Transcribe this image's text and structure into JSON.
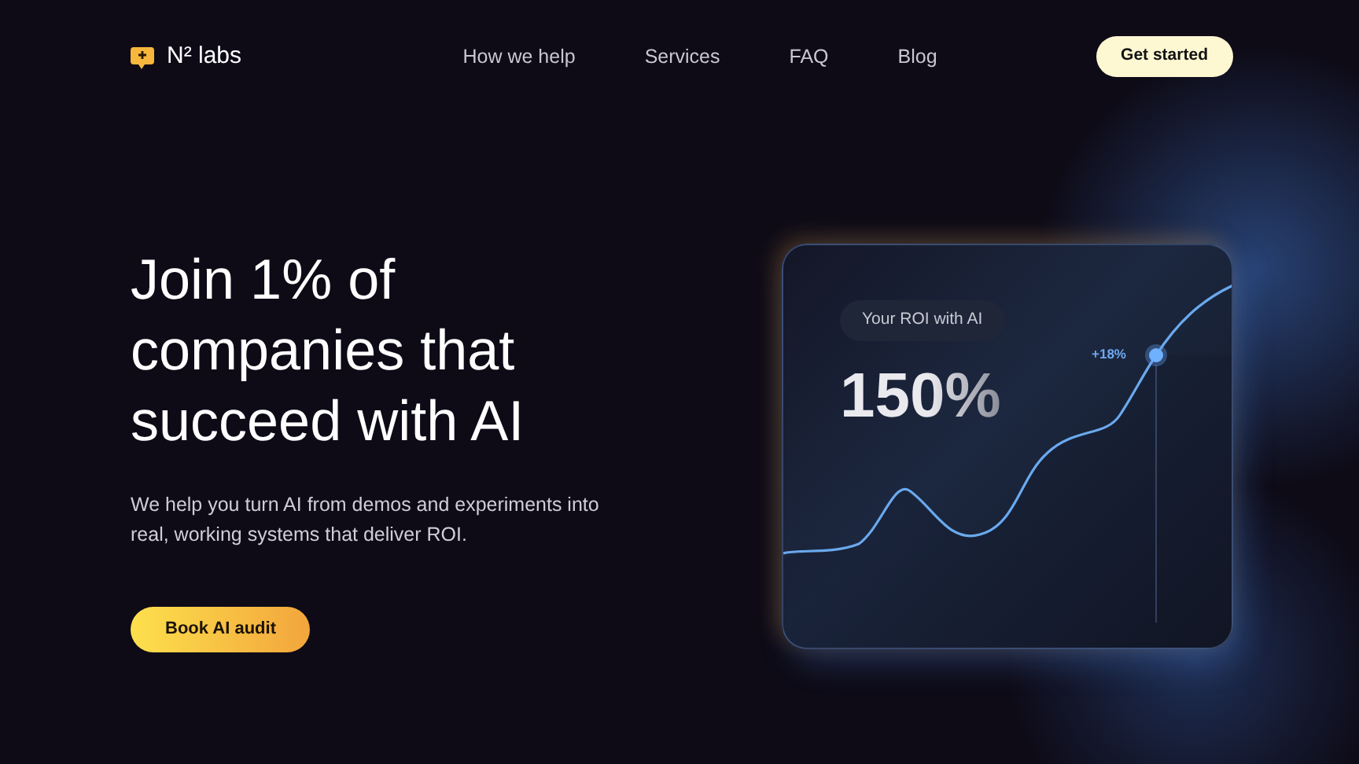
{
  "brand": {
    "name": "N² labs"
  },
  "nav": {
    "links": [
      "How we help",
      "Services",
      "FAQ",
      "Blog"
    ],
    "cta": "Get started"
  },
  "hero": {
    "heading": "Join 1% of companies that succeed with AI",
    "text": "We help you turn AI from demos and experiments into real, working systems that deliver ROI.",
    "button": "Book AI audit"
  },
  "roi_card": {
    "label": "Your ROI with AI",
    "value": "150%",
    "change": "+18%"
  }
}
